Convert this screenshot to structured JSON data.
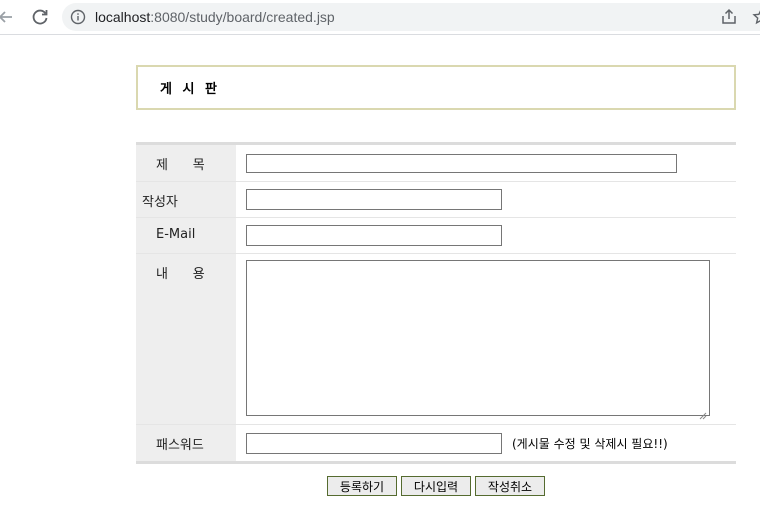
{
  "browser": {
    "url_host": "localhost",
    "url_rest": ":8080/study/board/created.jsp"
  },
  "board": {
    "title": "게 시 판"
  },
  "form": {
    "subject_label": "제      목",
    "writer_label": "작성자",
    "email_label": "E-Mail",
    "content_label": "내      용",
    "password_label": "패스워드",
    "subject_value": "",
    "writer_value": "",
    "email_value": "",
    "content_value": "",
    "password_value": "",
    "password_hint": "(게시물 수정 및 삭제시 필요!!)"
  },
  "buttons": {
    "submit_label": "등록하기",
    "reset_label": "다시입력",
    "cancel_label": "작성취소"
  },
  "colors": {
    "title_border": "#dad8b0",
    "label_bg": "#eeeeee",
    "button_border": "#556b2f"
  }
}
